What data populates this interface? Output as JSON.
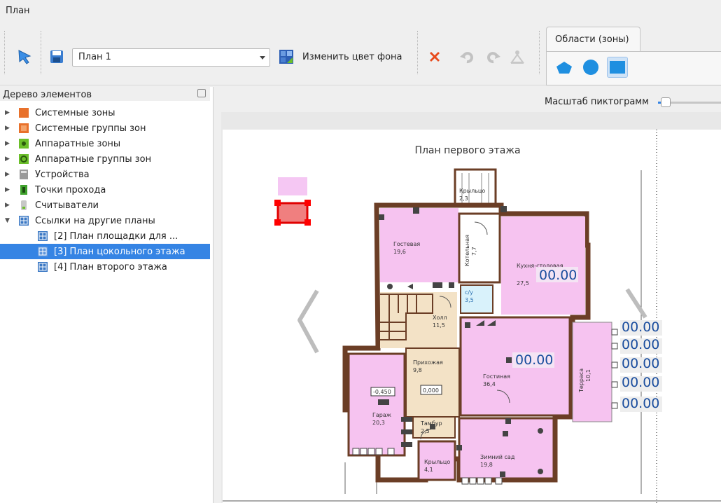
{
  "menubar": {
    "plan_menu": "План"
  },
  "toolbar": {
    "plan_select": "План 1",
    "change_bg_label": "Изменить цвет фона",
    "zones_tab": "Области (зоны)"
  },
  "sidebar": {
    "title": "Дерево элементов",
    "items": [
      {
        "label": "Системные зоны",
        "icon": "system-zone-icon",
        "color": "#e8712b"
      },
      {
        "label": "Системные группы зон",
        "icon": "system-zone-group-icon",
        "color": "#e8712b"
      },
      {
        "label": "Аппаратные зоны",
        "icon": "hardware-zone-icon",
        "color": "#6bbf2a"
      },
      {
        "label": "Аппаратные группы зон",
        "icon": "hardware-zone-group-icon",
        "color": "#6bbf2a"
      },
      {
        "label": "Устройства",
        "icon": "device-icon",
        "color": "#8a8a8a"
      },
      {
        "label": "Точки прохода",
        "icon": "access-point-icon",
        "color": "#3fa22d"
      },
      {
        "label": "Считыватели",
        "icon": "reader-icon",
        "color": "#b0b0b0"
      },
      {
        "label": "Ссылки на другие планы",
        "icon": "plan-link-icon",
        "color": "#3b78c4"
      }
    ],
    "children": [
      {
        "label": "[2] План площадки для ..."
      },
      {
        "label": "[3] План цокольного этажа"
      },
      {
        "label": "[4] План второго этажа"
      }
    ]
  },
  "scale": {
    "label": "Масштаб пиктограмм",
    "value": 0.05
  },
  "plan": {
    "title": "План первого этажа",
    "rooms": [
      {
        "name": "Гостевая",
        "area": "19,6"
      },
      {
        "name": "Котельная",
        "area": "7,7"
      },
      {
        "name": "Кухня-столовая",
        "area": "27,5"
      },
      {
        "name": "с/у",
        "area": "3,5"
      },
      {
        "name": "Холл",
        "area": "11,5"
      },
      {
        "name": "Прихожая",
        "area": "9,8"
      },
      {
        "name": "Гостиная",
        "area": "36,4"
      },
      {
        "name": "Терраса",
        "area": "10,1"
      },
      {
        "name": "Гараж",
        "area": "20,3"
      },
      {
        "name": "Тамбур",
        "area": "2,5"
      },
      {
        "name": "Крыльцо",
        "area": "4,1"
      },
      {
        "name": "Зимний сад",
        "area": "19,8"
      },
      {
        "name": "Крыльцо",
        "area": "2,3"
      }
    ],
    "level_garage": "-0,450",
    "level_hall": "0,000",
    "readout": "00.00"
  }
}
